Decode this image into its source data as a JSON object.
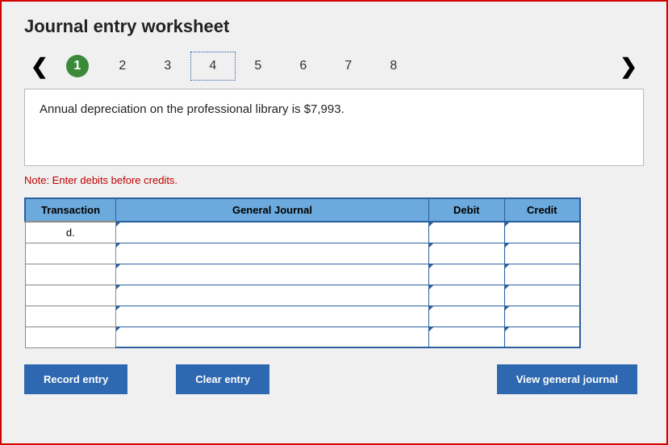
{
  "title": "Journal entry worksheet",
  "pager": {
    "steps": [
      "1",
      "2",
      "3",
      "4",
      "5",
      "6",
      "7",
      "8"
    ],
    "active": 1,
    "selected": 4
  },
  "prompt": "Annual depreciation on the professional library is $7,993.",
  "note": "Note: Enter debits before credits.",
  "table": {
    "headers": {
      "transaction": "Transaction",
      "general_journal": "General Journal",
      "debit": "Debit",
      "credit": "Credit"
    },
    "rows": [
      {
        "transaction": "d.",
        "gj": "",
        "debit": "",
        "credit": ""
      },
      {
        "transaction": "",
        "gj": "",
        "debit": "",
        "credit": ""
      },
      {
        "transaction": "",
        "gj": "",
        "debit": "",
        "credit": ""
      },
      {
        "transaction": "",
        "gj": "",
        "debit": "",
        "credit": ""
      },
      {
        "transaction": "",
        "gj": "",
        "debit": "",
        "credit": ""
      },
      {
        "transaction": "",
        "gj": "",
        "debit": "",
        "credit": ""
      }
    ]
  },
  "buttons": {
    "record": "Record entry",
    "clear": "Clear entry",
    "view": "View general journal"
  }
}
